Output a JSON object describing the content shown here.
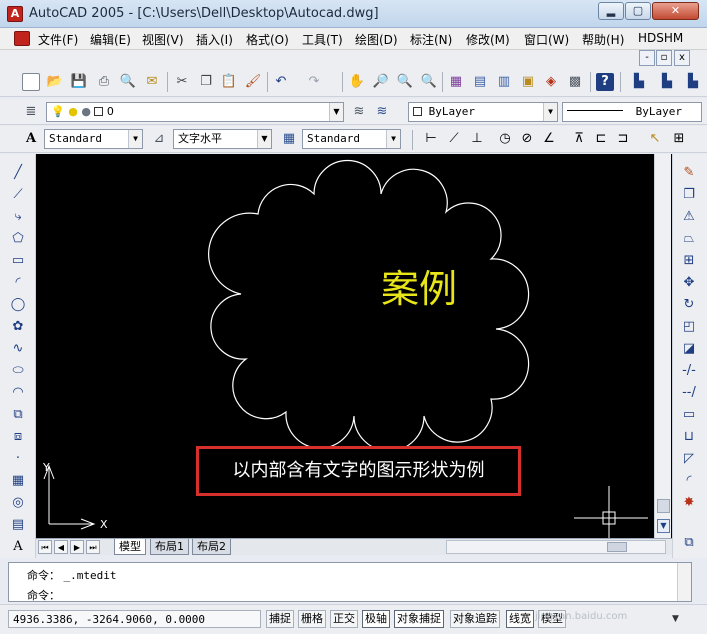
{
  "window": {
    "title": "AutoCAD 2005 - [C:\\Users\\Dell\\Desktop\\Autocad.dwg]",
    "min_label": "▂",
    "max_label": "▢",
    "close_label": "✕"
  },
  "menu": {
    "items": [
      "文件(F)",
      "编辑(E)",
      "视图(V)",
      "插入(I)",
      "格式(O)",
      "工具(T)",
      "绘图(D)",
      "标注(N)",
      "修改(M)",
      "窗口(W)",
      "帮助(H)",
      "HDSHM"
    ],
    "mdi_min": "-",
    "mdi_restore": "▫",
    "mdi_close": "x"
  },
  "layers": {
    "current_layer": "0",
    "color": "ByLayer",
    "linetype": "ByLayer"
  },
  "styles": {
    "text_style": "Standard",
    "text_align": "文字水平",
    "dim_style": "Standard"
  },
  "drawing": {
    "text": "案例",
    "text_color": "#e8e619",
    "cloud_color": "#ffffff",
    "ucs_x": "X",
    "ucs_y": "Y"
  },
  "layout_tabs": [
    "模型",
    "布局1",
    "布局2"
  ],
  "command": {
    "line1_prompt": "命令：",
    "line1_value": "_.mtedit",
    "line2_prompt": "命令："
  },
  "status": {
    "coords": "4936.3386, -3264.9060, 0.0000",
    "buttons": [
      {
        "label": "捕捉",
        "on": false
      },
      {
        "label": "栅格",
        "on": false
      },
      {
        "label": "正交",
        "on": false
      },
      {
        "label": "极轴",
        "on": true
      },
      {
        "label": "对象捕捉",
        "on": true
      },
      {
        "label": "对象追踪",
        "on": false
      },
      {
        "label": "线宽",
        "on": true
      },
      {
        "label": "模型",
        "on": false
      }
    ],
    "watermark": "jingyan.baidu.com"
  },
  "caption": "以内部含有文字的图示形状为例"
}
